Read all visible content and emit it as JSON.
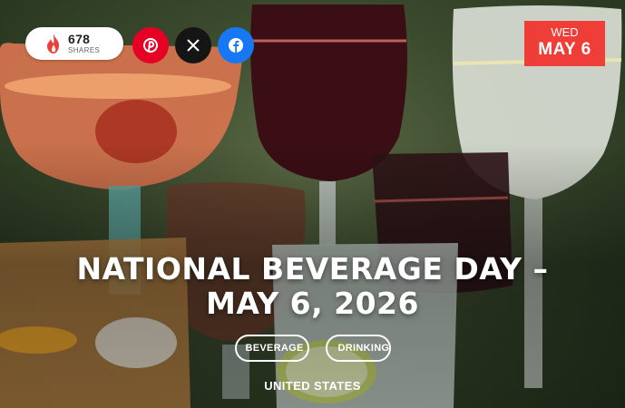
{
  "share": {
    "count": "678",
    "label": "SHARES"
  },
  "social": [
    {
      "name": "pinterest",
      "glyph": "P"
    },
    {
      "name": "x",
      "glyph": "X"
    },
    {
      "name": "facebook",
      "glyph": "f"
    }
  ],
  "date": {
    "dow": "WED",
    "month_day": "MAY 6"
  },
  "title": {
    "line1": "NATIONAL BEVERAGE DAY –",
    "line2": "MAY 6, 2026"
  },
  "tags": [
    "BEVERAGE",
    "DRINKING"
  ],
  "country": "UNITED STATES",
  "colors": {
    "accent_red": "#ef3d37",
    "pinterest": "#e60023",
    "x": "#151515",
    "facebook": "#1877f2"
  }
}
